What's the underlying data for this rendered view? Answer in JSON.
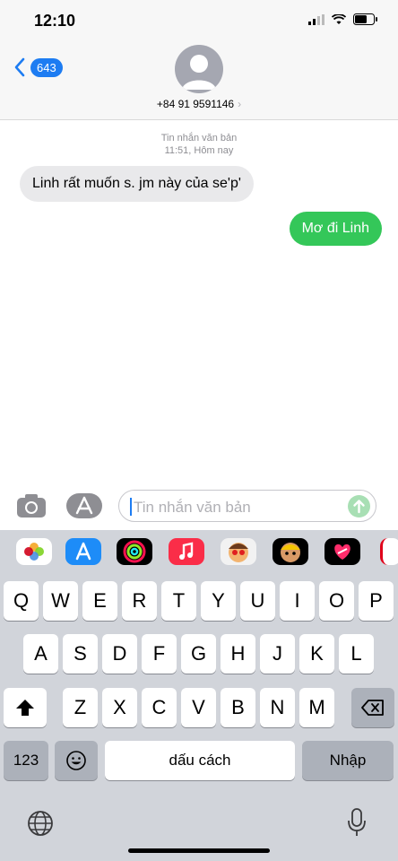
{
  "status": {
    "time": "12:10"
  },
  "nav": {
    "back_count": "643",
    "contact": "+84 91 9591146"
  },
  "thread": {
    "meta_type": "Tin nhắn văn bản",
    "meta_time": "11:51, Hôm nay",
    "messages": [
      {
        "direction": "in",
        "text": "Linh rất muốn s. jm này của  se'p'"
      },
      {
        "direction": "out",
        "text": "Mơ đi Linh"
      }
    ]
  },
  "composer": {
    "placeholder": "Tin nhắn văn bản"
  },
  "apps": [
    "photos-icon",
    "appstore-icon",
    "activity-icon",
    "music-icon",
    "memoji-1-icon",
    "memoji-2-icon",
    "digital-touch-icon",
    "app-partial-icon"
  ],
  "keyboard": {
    "row1": [
      "Q",
      "W",
      "E",
      "R",
      "T",
      "Y",
      "U",
      "I",
      "O",
      "P"
    ],
    "row2": [
      "A",
      "S",
      "D",
      "F",
      "G",
      "H",
      "J",
      "K",
      "L"
    ],
    "row3": [
      "Z",
      "X",
      "C",
      "V",
      "B",
      "N",
      "M"
    ],
    "numbers": "123",
    "space": "dấu cách",
    "return": "Nhập"
  },
  "colors": {
    "accent": "#1d7cf2",
    "outgoing": "#34c759",
    "incoming": "#e9e9eb",
    "keyboard_bg": "#d1d4da"
  }
}
